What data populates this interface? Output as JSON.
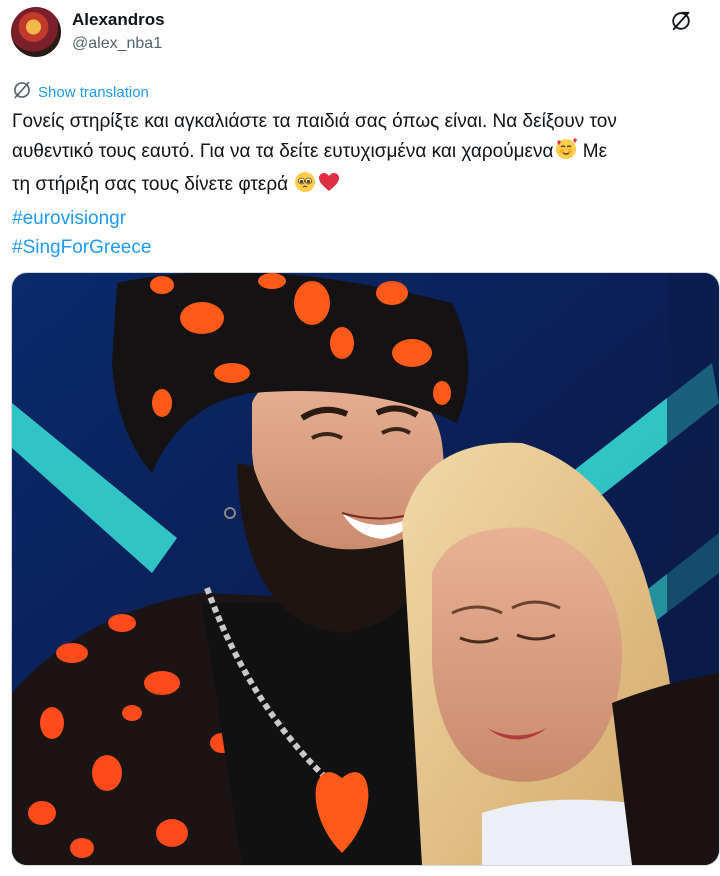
{
  "author": {
    "name": "Alexandros",
    "handle": "@alex_nba1"
  },
  "icons": {
    "more": "no-translate-icon",
    "translate": "globe-strike-icon"
  },
  "translation_link": "Show translation",
  "tweet": {
    "line1": "Γονείς στηρίξτε και αγκαλιάστε τα παιδιά σας όπως είναι. Να δείξουν τον",
    "line2": "αυθεντικό τους εαυτό. Για να τα δείτε ευτυχισμένα και χαρούμενα",
    "line2_after_emoji": " Με",
    "line3": "τη στήριξη σας τους δίνετε φτερά ",
    "hashtags": [
      "#eurovisiongr",
      "#SingForGreece"
    ]
  },
  "colors": {
    "link": "#1d9bf0",
    "text": "#0f1419",
    "muted": "#536471"
  }
}
